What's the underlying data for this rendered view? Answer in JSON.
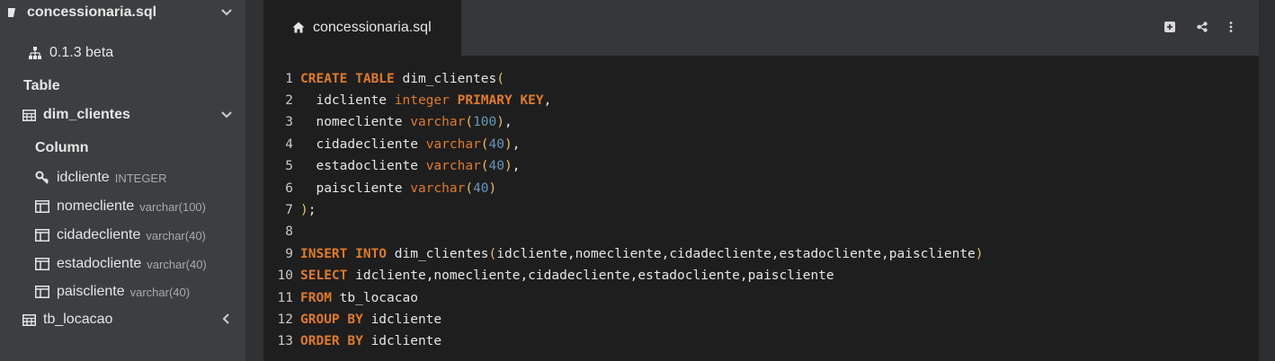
{
  "sidebar": {
    "db_name": "concessionaria.sql",
    "version": "0.1.3 beta",
    "table_heading": "Table",
    "tables": [
      {
        "name": "dim_clientes",
        "column_heading": "Column",
        "columns": [
          {
            "name": "idcliente",
            "type": "INTEGER",
            "icon": "key-icon"
          },
          {
            "name": "nomecliente",
            "type": "varchar(100)",
            "icon": "column-icon"
          },
          {
            "name": "cidadecliente",
            "type": "varchar(40)",
            "icon": "column-icon"
          },
          {
            "name": "estadocliente",
            "type": "varchar(40)",
            "icon": "column-icon"
          },
          {
            "name": "paiscliente",
            "type": "varchar(40)",
            "icon": "column-icon"
          }
        ]
      },
      {
        "name": "tb_locacao"
      }
    ]
  },
  "editor": {
    "tab_label": "concessionaria.sql",
    "tools": [
      "add-icon",
      "share-icon",
      "more-icon"
    ],
    "lines": [
      {
        "n": "1",
        "t": [
          [
            "kw",
            "CREATE TABLE"
          ],
          [
            "plain",
            " dim_clientes"
          ],
          [
            "pn",
            "("
          ]
        ]
      },
      {
        "n": "2",
        "t": [
          [
            "plain",
            "  idcliente "
          ],
          [
            "ty",
            "integer"
          ],
          [
            "plain",
            " "
          ],
          [
            "kw",
            "PRIMARY KEY"
          ],
          [
            "plain",
            ","
          ]
        ]
      },
      {
        "n": "3",
        "t": [
          [
            "plain",
            "  nomecliente "
          ],
          [
            "ty",
            "varchar"
          ],
          [
            "pn",
            "("
          ],
          [
            "num",
            "100"
          ],
          [
            "pn",
            ")"
          ],
          [
            "plain",
            ","
          ]
        ]
      },
      {
        "n": "4",
        "t": [
          [
            "plain",
            "  cidadecliente "
          ],
          [
            "ty",
            "varchar"
          ],
          [
            "pn",
            "("
          ],
          [
            "num",
            "40"
          ],
          [
            "pn",
            ")"
          ],
          [
            "plain",
            ","
          ]
        ]
      },
      {
        "n": "5",
        "t": [
          [
            "plain",
            "  estadocliente "
          ],
          [
            "ty",
            "varchar"
          ],
          [
            "pn",
            "("
          ],
          [
            "num",
            "40"
          ],
          [
            "pn",
            ")"
          ],
          [
            "plain",
            ","
          ]
        ]
      },
      {
        "n": "6",
        "t": [
          [
            "plain",
            "  paiscliente "
          ],
          [
            "ty",
            "varchar"
          ],
          [
            "pn",
            "("
          ],
          [
            "num",
            "40"
          ],
          [
            "pn",
            ")"
          ]
        ]
      },
      {
        "n": "7",
        "t": [
          [
            "pn",
            ")"
          ],
          [
            "plain",
            ";"
          ]
        ]
      },
      {
        "n": "8",
        "t": []
      },
      {
        "n": "9",
        "t": [
          [
            "kw",
            "INSERT INTO"
          ],
          [
            "plain",
            " dim_clientes"
          ],
          [
            "pn",
            "("
          ],
          [
            "plain",
            "idcliente,nomecliente,cidadecliente,estadocliente,paiscliente"
          ],
          [
            "pn",
            ")"
          ]
        ]
      },
      {
        "n": "10",
        "t": [
          [
            "kw",
            "SELECT"
          ],
          [
            "plain",
            " idcliente,nomecliente,cidadecliente,estadocliente,paiscliente"
          ]
        ]
      },
      {
        "n": "11",
        "t": [
          [
            "kw",
            "FROM"
          ],
          [
            "plain",
            " tb_locacao"
          ]
        ]
      },
      {
        "n": "12",
        "t": [
          [
            "kw",
            "GROUP BY"
          ],
          [
            "plain",
            " idcliente"
          ]
        ]
      },
      {
        "n": "13",
        "t": [
          [
            "kw",
            "ORDER BY"
          ],
          [
            "plain",
            " idcliente"
          ]
        ]
      }
    ]
  },
  "colors": {
    "keyword": "#e07b2a",
    "number": "#6897bb",
    "paren": "#e8bf6a",
    "editor_bg": "#1e1e1e",
    "sidebar_bg": "#3c3f41"
  }
}
